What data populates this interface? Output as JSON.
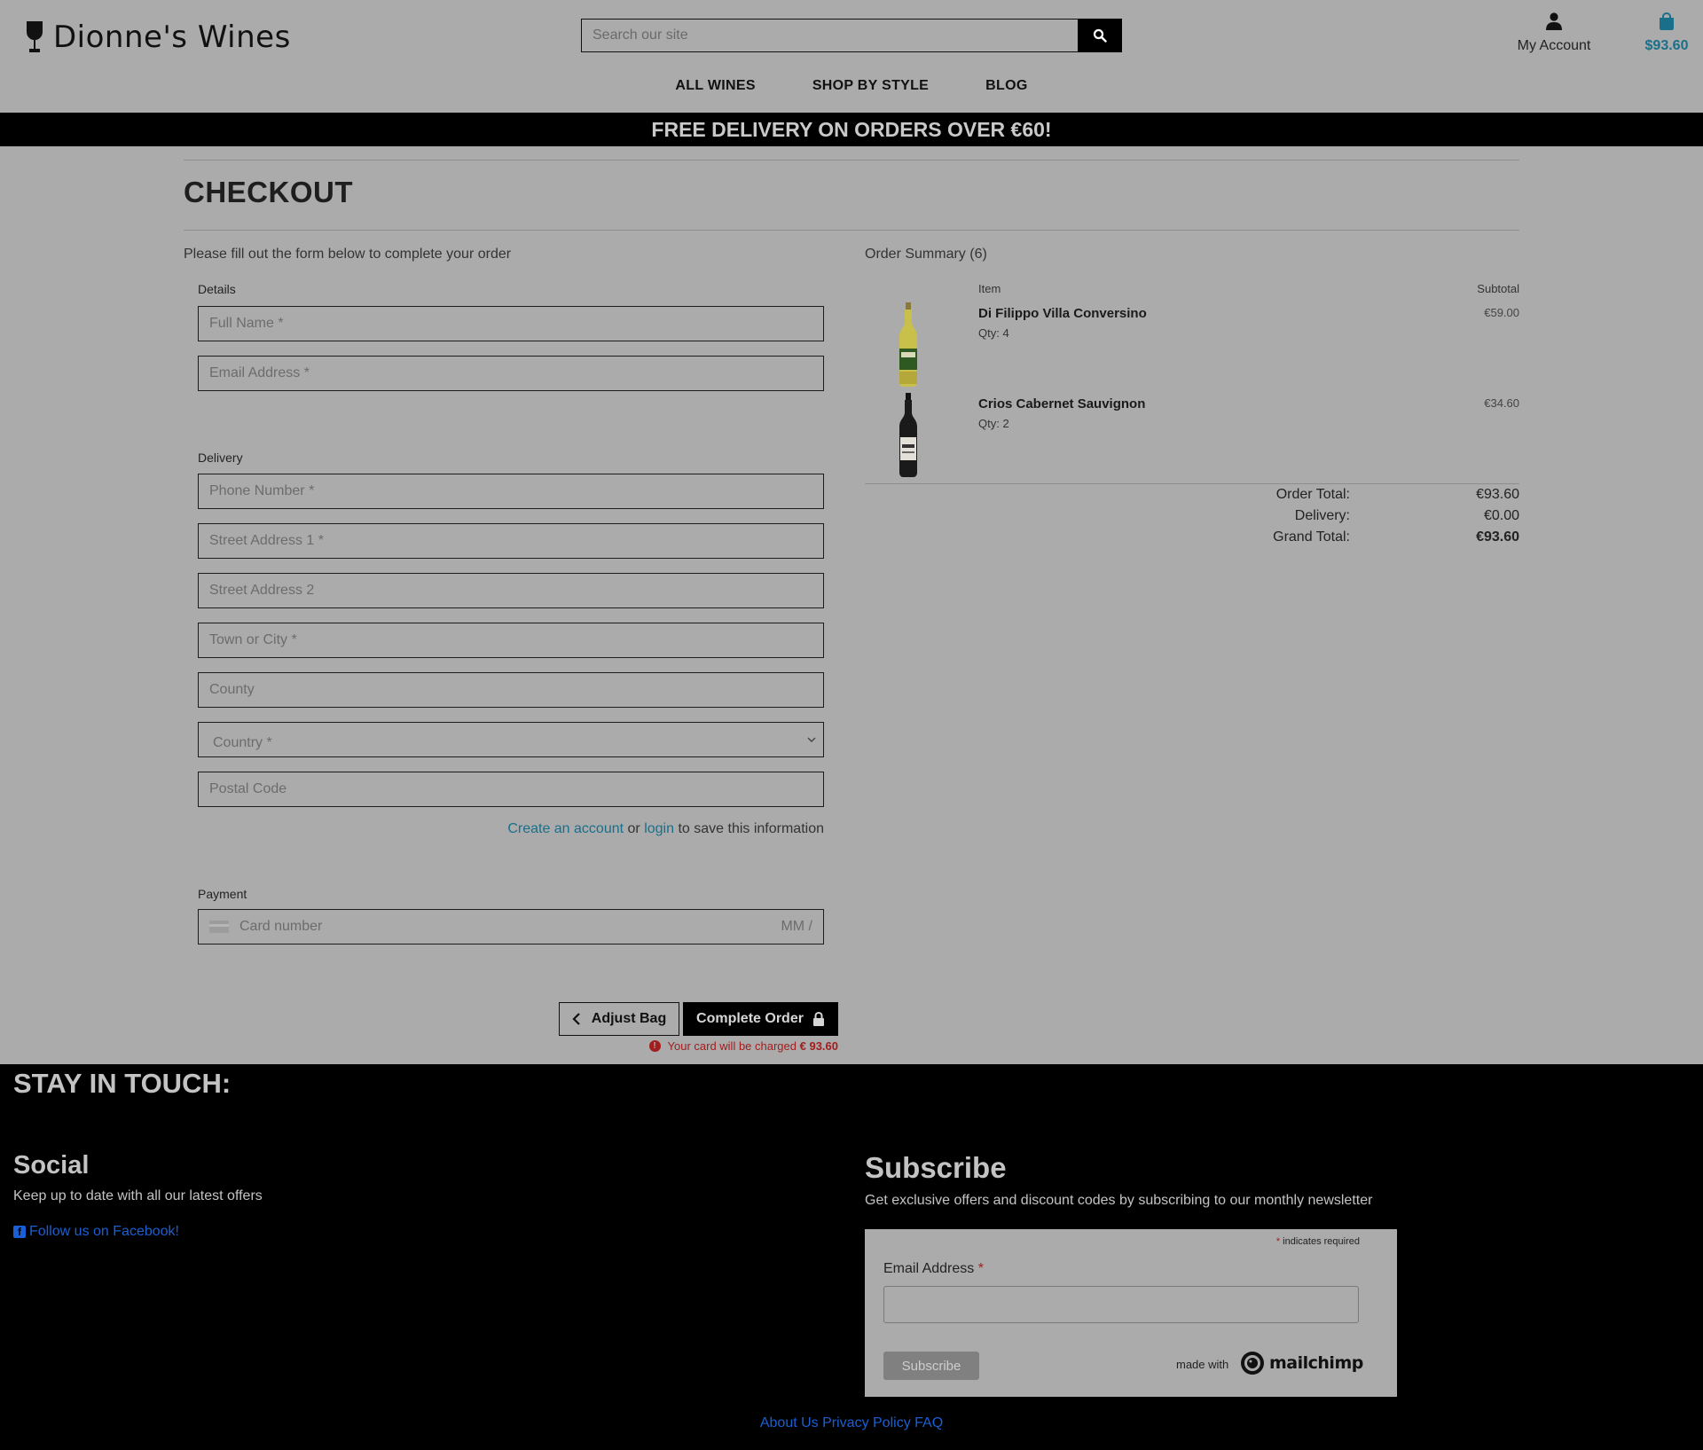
{
  "header": {
    "logo_text": "Dionne's Wines",
    "search_placeholder": "Search our site",
    "account_label": "My Account",
    "bag_total": "$93.60",
    "accent_color": "#1a6f8a"
  },
  "nav": {
    "items": [
      "ALL WINES",
      "SHOP BY STYLE",
      "BLOG"
    ]
  },
  "banner": {
    "text": "FREE DELIVERY ON ORDERS OVER €60!"
  },
  "checkout": {
    "title": "CHECKOUT",
    "intro": "Please fill out the form below to complete your order",
    "details_label": "Details",
    "full_name_placeholder": "Full Name *",
    "email_placeholder": "Email Address *",
    "delivery_label": "Delivery",
    "phone_placeholder": "Phone Number *",
    "street1_placeholder": "Street Address 1 *",
    "street2_placeholder": "Street Address 2",
    "town_placeholder": "Town or City *",
    "county_placeholder": "County",
    "country_value": "Country *",
    "postal_placeholder": "Postal Code",
    "create_account_link": "Create an account",
    "or_text": "or",
    "login_link": "login",
    "save_info_text": "to save this information",
    "payment_label": "Payment",
    "card_placeholder": "Card number",
    "card_mm": "MM /",
    "adjust_bag_label": "Adjust Bag",
    "complete_order_label": "Complete Order",
    "charge_text": "Your card will be charged",
    "charge_amount": "€ 93.60"
  },
  "summary": {
    "title": "Order Summary (6)",
    "col_item": "Item",
    "col_subtotal": "Subtotal",
    "items": [
      {
        "name": "Di Filippo Villa Conversino",
        "qty": "Qty: 4",
        "price": "€59.00"
      },
      {
        "name": "Crios Cabernet Sauvignon",
        "qty": "Qty: 2",
        "price": "€34.60"
      }
    ],
    "order_total_label": "Order Total:",
    "order_total": "€93.60",
    "delivery_label": "Delivery:",
    "delivery": "€0.00",
    "grand_total_label": "Grand Total:",
    "grand_total": "€93.60"
  },
  "footer": {
    "stay_in_touch": "STAY IN TOUCH:",
    "social_heading": "Social",
    "social_text": "Keep up to date with all our latest offers",
    "facebook_link": "Follow us on Facebook!",
    "subscribe_heading": "Subscribe",
    "subscribe_text": "Get exclusive offers and discount codes by subscribing to our monthly newsletter",
    "required_note": "indicates required",
    "required_star": "*",
    "email_label": "Email Address",
    "subscribe_button": "Subscribe",
    "made_with": "made with",
    "mailchimp": "mailchimp",
    "links": [
      "About Us",
      "Privacy Policy",
      "FAQ"
    ]
  }
}
